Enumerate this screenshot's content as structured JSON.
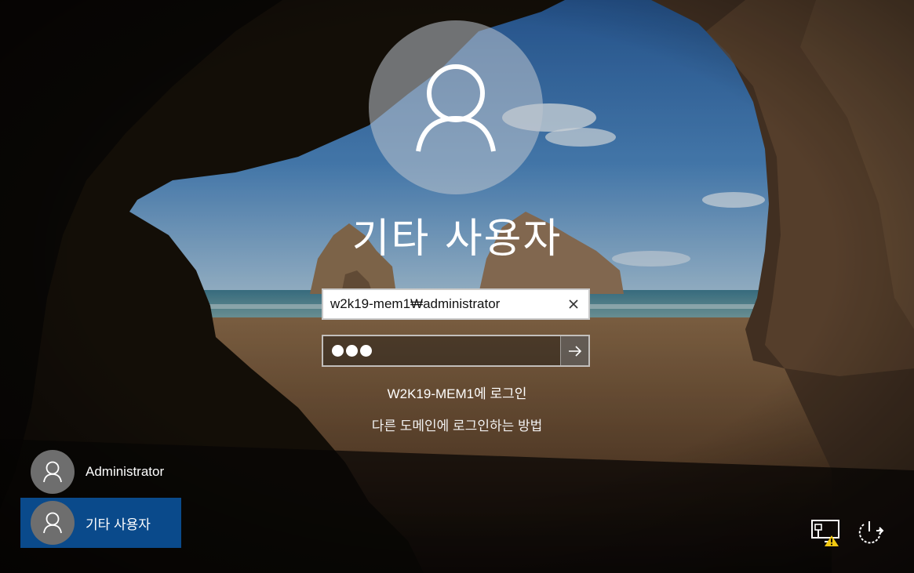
{
  "title": "기타 사용자",
  "username_field": {
    "value": "w2k19-mem1₩administrator",
    "clear_icon": "close-icon"
  },
  "password_field": {
    "dot_count": 3,
    "submit_icon": "arrow-right-icon"
  },
  "signin_to": "W2K19-MEM1에 로그인",
  "other_domain_link": "다른 도메인에 로그인하는 방법",
  "users": [
    {
      "name": "Administrator",
      "icon": "user-icon",
      "selected": false
    },
    {
      "name": "기타 사용자",
      "icon": "user-icon",
      "selected": true
    }
  ],
  "tray": [
    {
      "icon": "network-warning-icon"
    },
    {
      "icon": "power-icon"
    }
  ],
  "colors": {
    "selected_user_bg": "#0a4a8b",
    "warning": "#f2c811"
  }
}
